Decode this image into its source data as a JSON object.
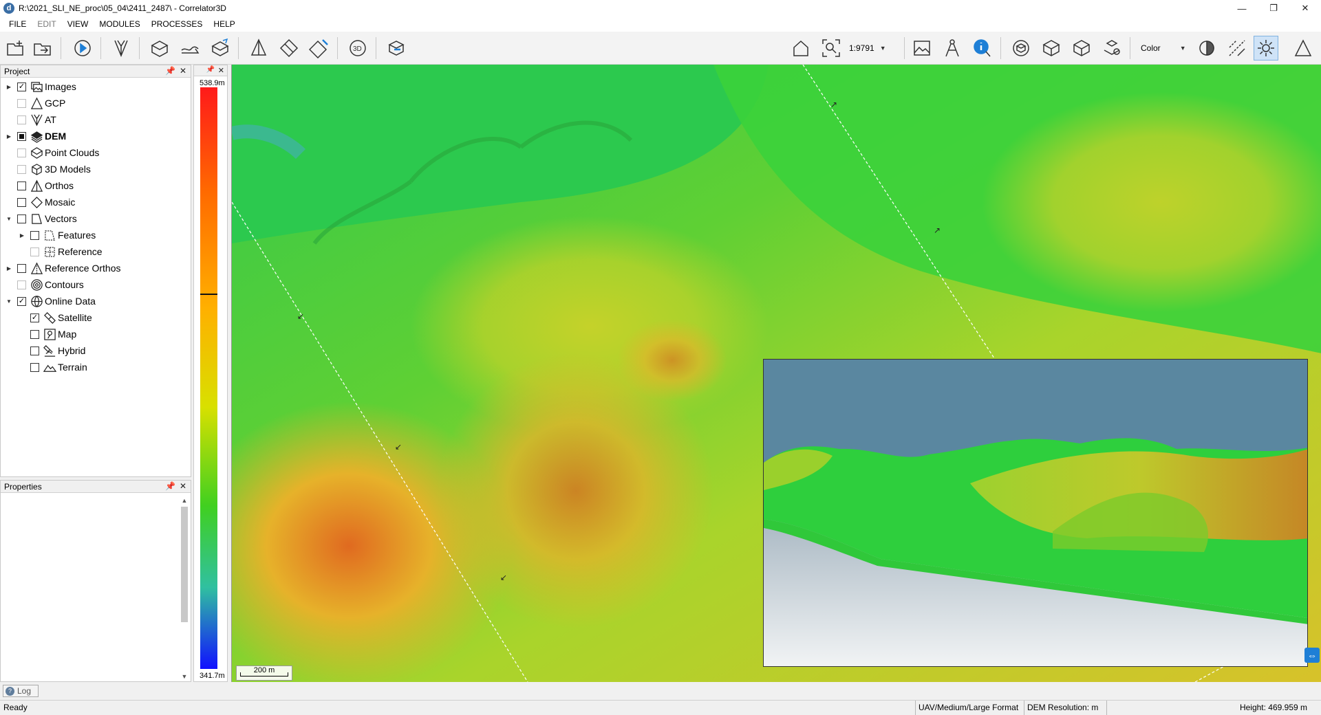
{
  "window": {
    "title": "R:\\2021_SLI_NE_proc\\05_04\\2411_2487\\ - Correlator3D",
    "minimize": "—",
    "restore": "❐",
    "close": "✕",
    "app_icon_glyph": "d"
  },
  "menu": [
    "FILE",
    "EDIT",
    "VIEW",
    "MODULES",
    "PROCESSES",
    "HELP"
  ],
  "toolbar": {
    "scale_value": "1:9791",
    "display_mode": "Color",
    "view_3d_label": "3D"
  },
  "project_panel": {
    "title": "Project",
    "items": [
      {
        "label": "Images",
        "expander": "▶",
        "checked": "checked",
        "bold": false
      },
      {
        "label": "GCP",
        "expander": "",
        "checked": "dim",
        "bold": false
      },
      {
        "label": "AT",
        "expander": "",
        "checked": "dim",
        "bold": false
      },
      {
        "label": "DEM",
        "expander": "▶",
        "checked": "partial",
        "bold": true
      },
      {
        "label": "Point Clouds",
        "expander": "",
        "checked": "dim",
        "bold": false
      },
      {
        "label": "3D Models",
        "expander": "",
        "checked": "dim",
        "bold": false
      },
      {
        "label": "Orthos",
        "expander": "",
        "checked": "unchecked",
        "bold": false
      },
      {
        "label": "Mosaic",
        "expander": "",
        "checked": "unchecked",
        "bold": false
      },
      {
        "label": "Vectors",
        "expander": "▼",
        "checked": "unchecked",
        "bold": false
      },
      {
        "label": "Features",
        "expander": "▶",
        "checked": "unchecked",
        "bold": false
      },
      {
        "label": "Reference",
        "expander": "",
        "checked": "dim",
        "bold": false
      },
      {
        "label": "Reference Orthos",
        "expander": "▶",
        "checked": "unchecked",
        "bold": false
      },
      {
        "label": "Contours",
        "expander": "",
        "checked": "dim",
        "bold": false
      },
      {
        "label": "Online Data",
        "expander": "▼",
        "checked": "checked",
        "bold": false
      },
      {
        "label": "Satellite",
        "expander": "",
        "checked": "checked",
        "bold": false
      },
      {
        "label": "Map",
        "expander": "",
        "checked": "unchecked",
        "bold": false
      },
      {
        "label": "Hybrid",
        "expander": "",
        "checked": "unchecked",
        "bold": false
      },
      {
        "label": "Terrain",
        "expander": "",
        "checked": "unchecked",
        "bold": false
      }
    ]
  },
  "properties_panel": {
    "title": "Properties"
  },
  "legend": {
    "max": "538.9m",
    "min": "341.7m"
  },
  "viewport": {
    "scale_label": "200 m"
  },
  "log_tab": {
    "label": "Log"
  },
  "status": {
    "ready": "Ready",
    "camera_type": "UAV/Medium/Large Format",
    "dem_resolution": "DEM Resolution:      m",
    "height": "Height: 469.959 m"
  },
  "colors": {
    "accent": "#1e7fd6",
    "terrain_low": "#35d13a",
    "terrain_mid": "#d7d92a",
    "terrain_high": "#e07b22",
    "sky": "#5a87a0"
  }
}
